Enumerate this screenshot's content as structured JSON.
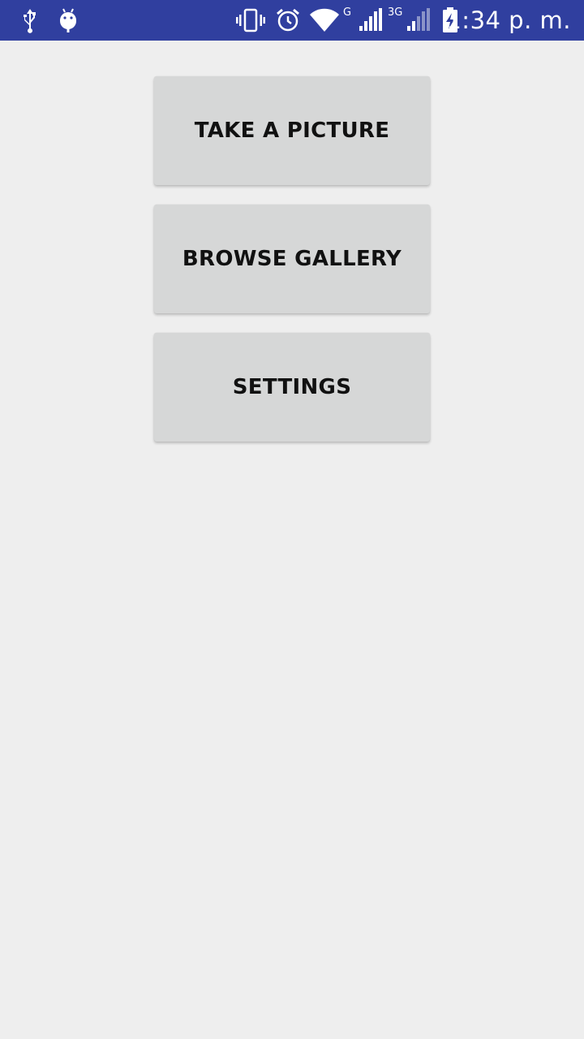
{
  "status_bar": {
    "time": "1:34 p. m.",
    "network_type_1": "G",
    "network_type_2": "3G",
    "color": "#303f9f",
    "icons": [
      "usb-icon",
      "android-debug-icon",
      "vibrate-icon",
      "alarm-icon",
      "wifi-icon",
      "signal-icon",
      "signal-icon",
      "battery-charging-icon"
    ]
  },
  "main": {
    "buttons": [
      {
        "label": "TAKE A PICTURE"
      },
      {
        "label": "BROWSE GALLERY"
      },
      {
        "label": "SETTINGS"
      }
    ],
    "background": "#eeeeee",
    "button_color": "#d6d7d7"
  }
}
